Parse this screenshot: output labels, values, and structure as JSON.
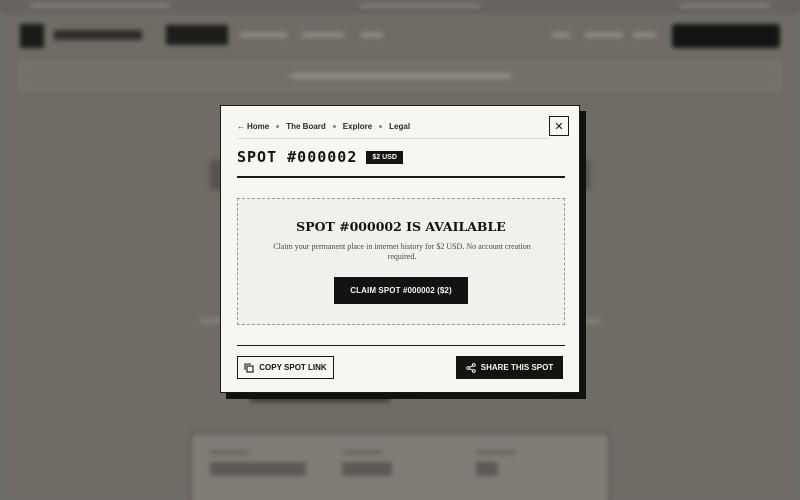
{
  "modal": {
    "breadcrumb": [
      {
        "label": "Home"
      },
      {
        "label": "The Board"
      },
      {
        "label": "Explore"
      },
      {
        "label": "Legal"
      }
    ],
    "back_arrow_glyph": "←",
    "close_glyph": "✕",
    "title": "SPOT #000002",
    "price_badge": "$2 USD",
    "availability": {
      "heading": "SPOT #000002 IS AVAILABLE",
      "description": "Claim your permanent place in internet history for $2 USD. No account creation required.",
      "claim_button": "CLAIM SPOT #000002 ($2)"
    },
    "copy_link_button": "COPY SPOT LINK",
    "share_button": "SHARE THIS SPOT"
  },
  "icons": {
    "back": "arrow-left-icon",
    "close": "close-icon",
    "copy": "copy-icon",
    "share": "share-icon"
  },
  "colors": {
    "overlay": "#6e6b66",
    "modal_bg": "#f7f6f1",
    "ink": "#141311",
    "dashed_border": "#9a9892"
  }
}
